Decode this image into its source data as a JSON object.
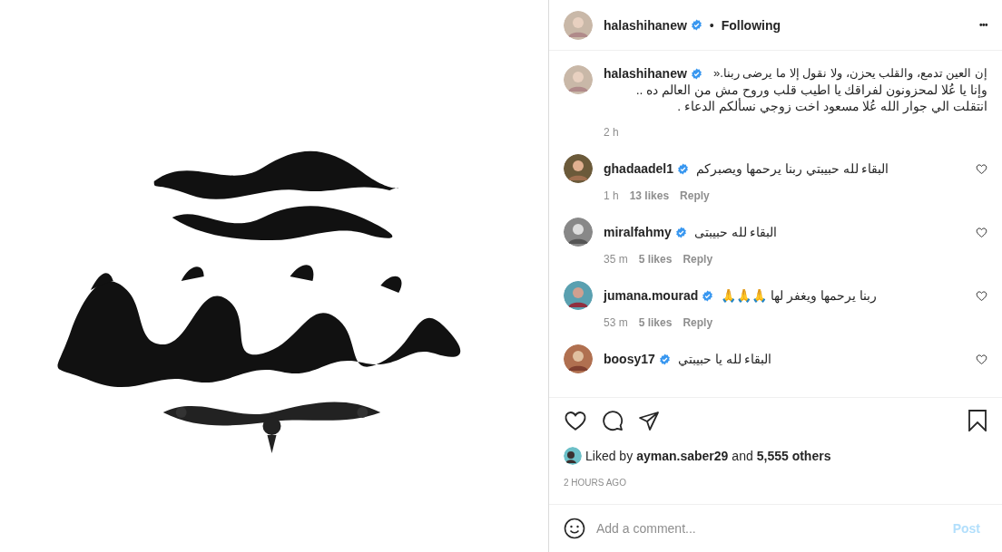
{
  "header": {
    "username": "halashihanew",
    "verified": true,
    "separator": "•",
    "follow_label": "Following",
    "more_icon": "•••"
  },
  "caption": {
    "username": "halashihanew",
    "verified": true,
    "lines": [
      "إن العين تدمع، والقلب يحزن، ولا نقول إلا ما يرضى ربنا.«",
      "وإنا يا عُلا لمحزونون لفراقك يا اطيب قلب وروح مش من العالم ده ..",
      "انتقلت الي جوار الله عُلا مسعود اخت زوجي نسألكم الدعاء ."
    ],
    "time": "2 h"
  },
  "comments": [
    {
      "username": "ghadaadel1",
      "verified": true,
      "text": "البقاء لله حبيبتي ربنا يرحمها ويصبركم",
      "time": "1 h",
      "likes": "13 likes",
      "reply": "Reply",
      "liked": false
    },
    {
      "username": "miralfahmy",
      "verified": true,
      "text": "البقاء لله حبيبتى",
      "time": "35 m",
      "likes": "5 likes",
      "reply": "Reply",
      "liked": false
    },
    {
      "username": "jumana.mourad",
      "verified": true,
      "text": "ربنا يرحمها ويغفر لها 🙏🙏🙏",
      "time": "53 m",
      "likes": "5 likes",
      "reply": "Reply",
      "liked": false
    },
    {
      "username": "boosy17",
      "verified": true,
      "text": "البقاء لله يا حبيبتي",
      "liked": false
    }
  ],
  "actions": {
    "liked": false,
    "saved": false
  },
  "likes": {
    "prefix": "Liked by",
    "user": "ayman.saber29",
    "middle": "and",
    "count": "5,555 others"
  },
  "posted": "2 HOURS AGO",
  "comment_box": {
    "placeholder": "Add a comment...",
    "post_label": "Post",
    "disabled": true
  }
}
